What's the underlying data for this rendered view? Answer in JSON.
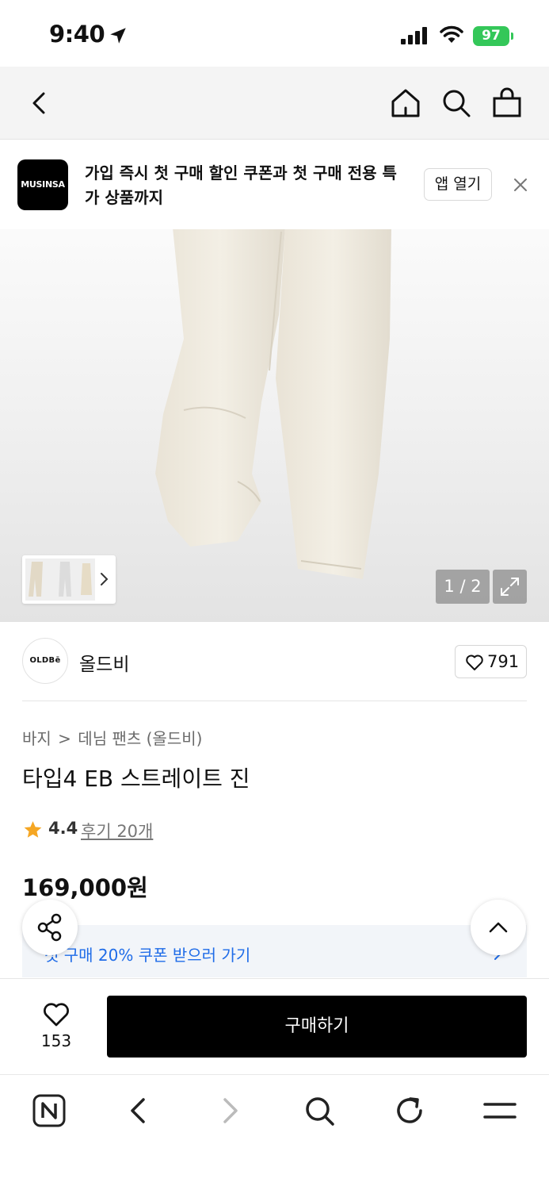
{
  "status_bar": {
    "time": "9:40",
    "battery": "97"
  },
  "banner": {
    "logo_text": "MUSINSA",
    "message": "가입 즉시 첫 구매 할인 쿠폰과 첫 구매 전용 특가 상품까지",
    "open_app_label": "앱 열기"
  },
  "gallery": {
    "counter": "1 / 2"
  },
  "brand": {
    "avatar_text": "OLDBē",
    "name": "올드비",
    "like_count": "791"
  },
  "breadcrumb": [
    "바지",
    ">",
    "데님 팬츠 (올드비)"
  ],
  "product": {
    "title": "타입4 EB 스트레이트 진",
    "rating": "4.4",
    "review_link": "후기 20개",
    "price": "169,000원"
  },
  "coupon": {
    "text": "첫 구매 20% 쿠폰 받으러 가기"
  },
  "purchase_bar": {
    "wish_count": "153",
    "buy_label": "구매하기"
  },
  "colors": {
    "accent_blue": "#1f6ce8",
    "star": "#f5a623",
    "battery": "#34c759",
    "buy_button": "#000000"
  }
}
